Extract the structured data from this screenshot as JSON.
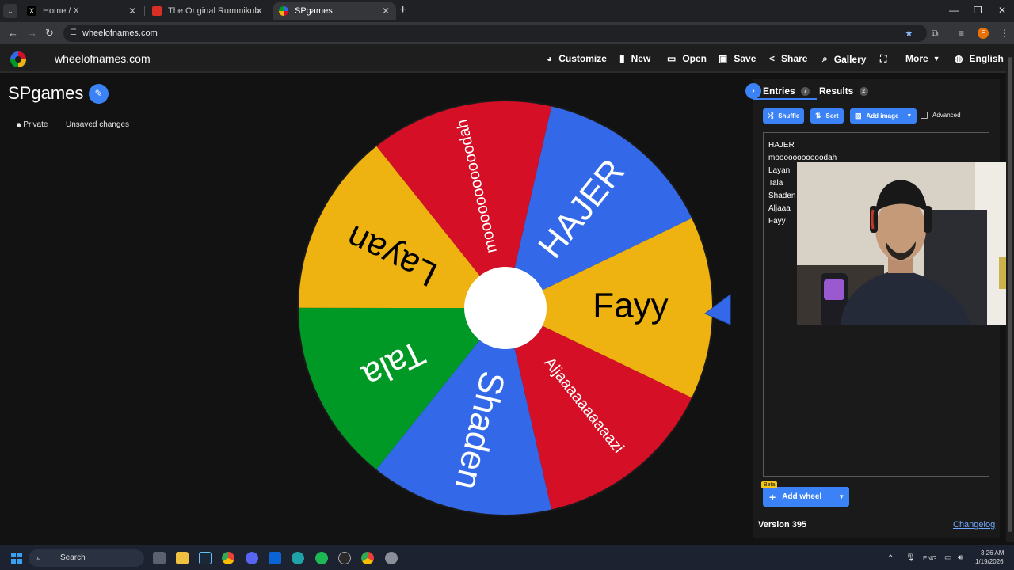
{
  "browser": {
    "tabs": [
      {
        "title": "Home / X",
        "favicon_color": "#000000"
      },
      {
        "title": "The Original Rummikub",
        "favicon_color": "#d93025"
      },
      {
        "title": "SPgames",
        "favicon_color": "#34a853"
      }
    ],
    "url": "wheelofnames.com",
    "profile_initial": "F"
  },
  "header": {
    "site_name": "wheelofnames.com",
    "menu": [
      {
        "label": "Customize",
        "icon": "palette-icon"
      },
      {
        "label": "New",
        "icon": "document-icon"
      },
      {
        "label": "Open",
        "icon": "folder-icon"
      },
      {
        "label": "Save",
        "icon": "save-icon"
      },
      {
        "label": "Share",
        "icon": "share-icon"
      },
      {
        "label": "Gallery",
        "icon": "search-icon"
      },
      {
        "label": "",
        "icon": "fullscreen-icon"
      },
      {
        "label": "More",
        "icon": "chevron-down-icon"
      },
      {
        "label": "English",
        "icon": "globe-icon"
      }
    ]
  },
  "page": {
    "title": "SPgames",
    "privacy": "Private",
    "status": "Unsaved changes"
  },
  "wheel": {
    "slices": [
      {
        "label": "HAJER",
        "color": "#3369e8"
      },
      {
        "label": "mooooooooooodah",
        "color": "#d50f25"
      },
      {
        "label": "Layan",
        "color": "#eeb211"
      },
      {
        "label": "Tala",
        "color": "#009925"
      },
      {
        "label": "Shaden",
        "color": "#3369e8"
      },
      {
        "label": "Aljaaaaaaaaaazi",
        "color": "#d50f25"
      },
      {
        "label": "Fayy",
        "color": "#eeb211"
      }
    ]
  },
  "sidebar": {
    "tabs": [
      {
        "label": "Entries",
        "count": "7"
      },
      {
        "label": "Results",
        "count": "2"
      }
    ],
    "buttons": {
      "shuffle": "Shuffle",
      "sort": "Sort",
      "add_image": "Add image",
      "advanced": "Advanced"
    },
    "entries": [
      "HAJER",
      "mooooooooooodah",
      "Layan",
      "Tala",
      "Shaden",
      "Aljaaa",
      "Fayy"
    ],
    "add_wheel": "Add wheel",
    "beta": "Beta",
    "version": "Version 395",
    "changelog": "Changelog"
  },
  "taskbar": {
    "search": "Search",
    "lang": "ENG",
    "time": "3:26 AM",
    "date": "1/19/2026"
  }
}
